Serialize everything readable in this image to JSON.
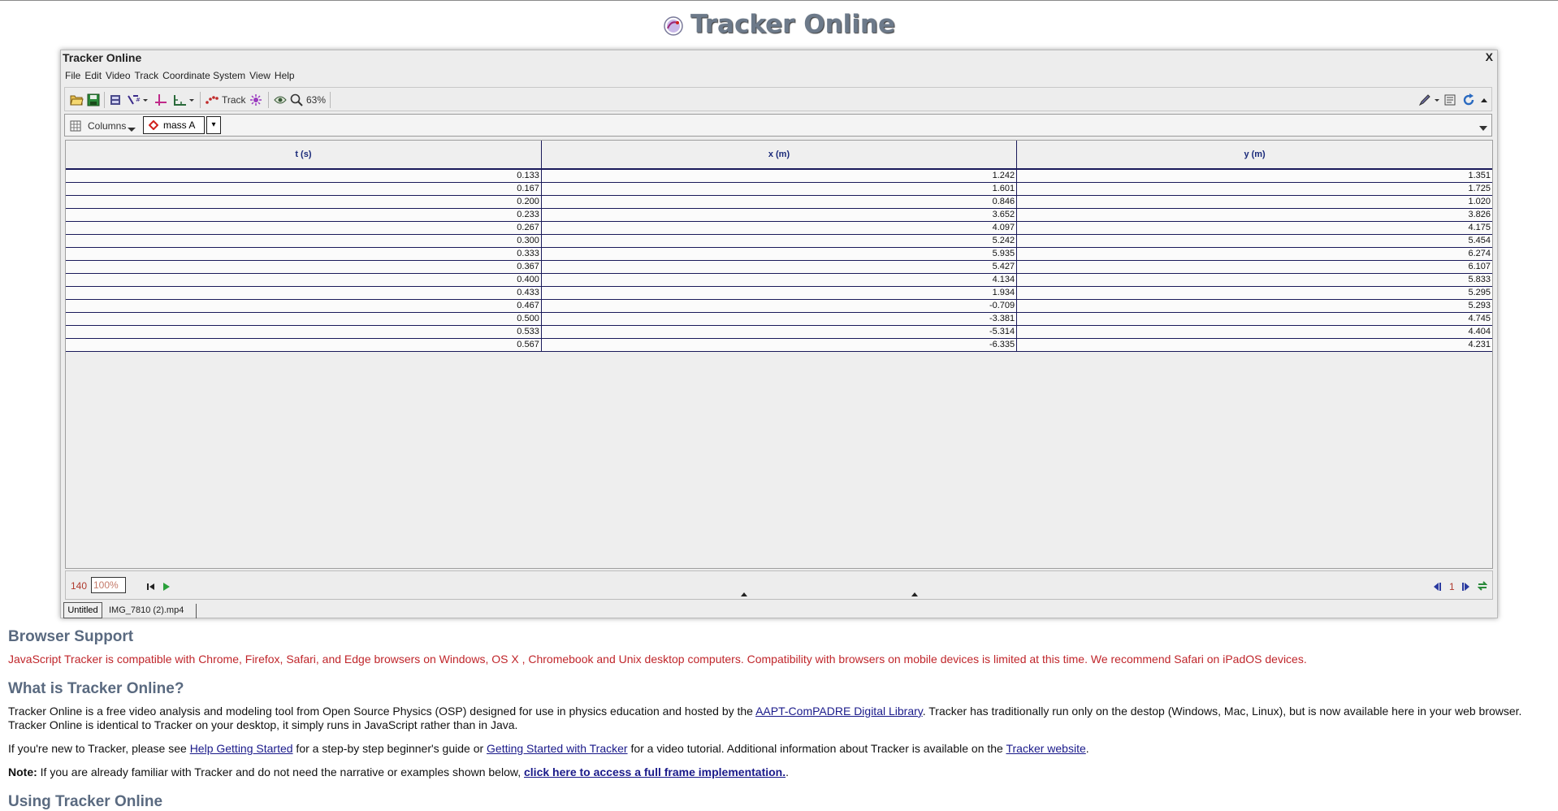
{
  "site": {
    "title": "Tracker Online"
  },
  "window": {
    "title": "Tracker Online",
    "close_label": "X",
    "menu": [
      "File",
      "Edit",
      "Video",
      "Track",
      "Coordinate System",
      "View",
      "Help"
    ]
  },
  "toolbar": {
    "track_label": "Track",
    "zoom_label": "63%"
  },
  "columns_bar": {
    "columns_label": "Columns",
    "track_name": "mass A",
    "track_color": "#d0201c"
  },
  "table": {
    "headers": [
      "t (s)",
      "x (m)",
      "y (m)"
    ],
    "rows": [
      [
        "0.133",
        "1.242",
        "1.351"
      ],
      [
        "0.167",
        "1.601",
        "1.725"
      ],
      [
        "0.200",
        "0.846",
        "1.020"
      ],
      [
        "0.233",
        "3.652",
        "3.826"
      ],
      [
        "0.267",
        "4.097",
        "4.175"
      ],
      [
        "0.300",
        "5.242",
        "5.454"
      ],
      [
        "0.333",
        "5.935",
        "6.274"
      ],
      [
        "0.367",
        "5.427",
        "6.107"
      ],
      [
        "0.400",
        "4.134",
        "5.833"
      ],
      [
        "0.433",
        "1.934",
        "5.295"
      ],
      [
        "0.467",
        "-0.709",
        "5.293"
      ],
      [
        "0.500",
        "-3.381",
        "4.745"
      ],
      [
        "0.533",
        "-5.314",
        "4.404"
      ],
      [
        "0.567",
        "-6.335",
        "4.231"
      ]
    ]
  },
  "player": {
    "frame": "140",
    "rate": "100%",
    "step": "1"
  },
  "tabs": {
    "active": "Untitled",
    "other": "IMG_7810 (2).mp4"
  },
  "content": {
    "browser_support": {
      "heading": "Browser Support",
      "text": "JavaScript Tracker is compatible with Chrome, Firefox, Safari, and Edge browsers on Windows, OS X , Chromebook and Unix desktop computers. Compatibility with browsers on mobile devices is limited at this time. We recommend Safari on iPadOS devices."
    },
    "what_is": {
      "heading": "What is Tracker Online?",
      "p1_before": "Tracker Online is a free video analysis and modeling tool from Open Source Physics (OSP) designed for use in physics education and hosted by the ",
      "p1_link": "AAPT-ComPADRE Digital Library",
      "p1_after": ". Tracker has traditionally run only on the destop (Windows, Mac, Linux), but is now available here in your web browser. Tracker Online is identical to Tracker on your desktop, it simply runs in JavaScript rather than in Java.",
      "p2_a": "If you're new to Tracker, please see ",
      "p2_link1": "Help Getting Started",
      "p2_b": " for a step-by step beginner's guide or ",
      "p2_link2": "Getting Started with Tracker",
      "p2_c": " for a video tutorial. Additional information about Tracker is available on the ",
      "p2_link3": "Tracker website",
      "p2_d": ".",
      "note_label": "Note:",
      "note_text": " If you are already familiar with Tracker and do not need the narrative or examples shown below, ",
      "note_link": "click here to access a full frame implementation.",
      "note_end": "."
    },
    "using": {
      "heading": "Using Tracker Online"
    }
  }
}
